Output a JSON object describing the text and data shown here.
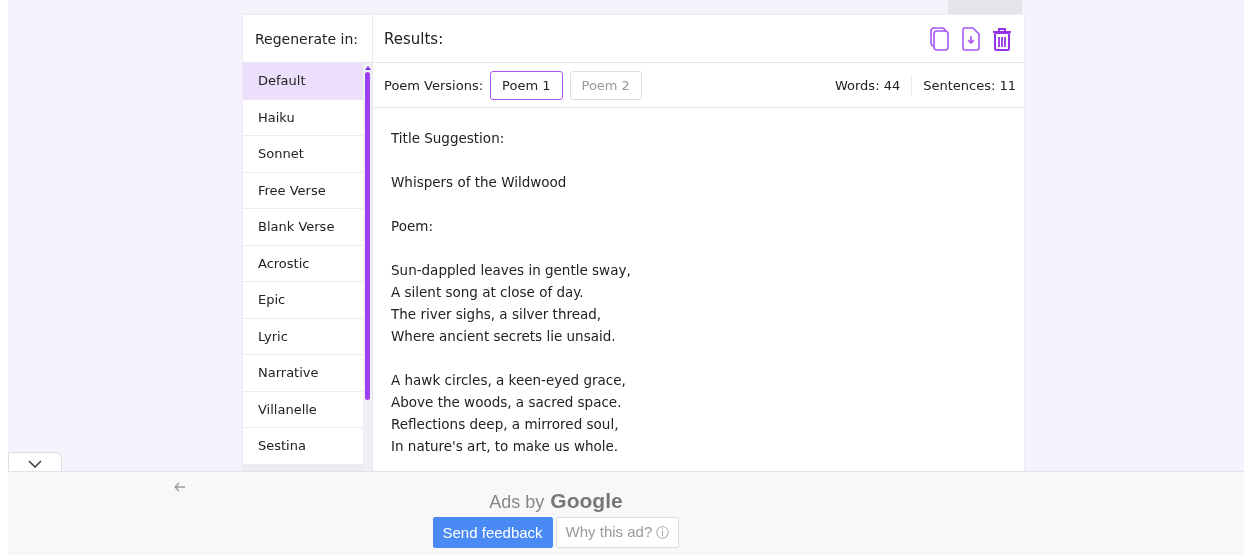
{
  "sidebar": {
    "title": "Regenerate in:",
    "items": [
      {
        "label": "Default",
        "selected": true
      },
      {
        "label": "Haiku",
        "selected": false
      },
      {
        "label": "Sonnet",
        "selected": false
      },
      {
        "label": "Free Verse",
        "selected": false
      },
      {
        "label": "Blank Verse",
        "selected": false
      },
      {
        "label": "Acrostic",
        "selected": false
      },
      {
        "label": "Epic",
        "selected": false
      },
      {
        "label": "Lyric",
        "selected": false
      },
      {
        "label": "Narrative",
        "selected": false
      },
      {
        "label": "Villanelle",
        "selected": false
      },
      {
        "label": "Sestina",
        "selected": false
      }
    ]
  },
  "results": {
    "title": "Results:",
    "versions_label": "Poem Versions:",
    "versions": [
      {
        "label": "Poem 1",
        "selected": true
      },
      {
        "label": "Poem 2",
        "selected": false
      }
    ],
    "stats": [
      "Words: 44",
      "Sentences: 11"
    ],
    "paragraphs": [
      [
        "Title Suggestion:"
      ],
      [
        "Whispers of the Wildwood"
      ],
      [
        "Poem:"
      ],
      [
        "Sun-dappled leaves in gentle sway,",
        "A silent song at close of day.",
        "The river sighs, a silver thread,",
        "Where ancient secrets lie unsaid."
      ],
      [
        "A hawk circles, a keen-eyed grace,",
        "Above the woods, a sacred space.",
        "Reflections deep, a mirrored soul,",
        "In nature's art, to make us whole."
      ]
    ]
  },
  "ads": {
    "label": "Ads by",
    "brand": "Google",
    "buttons": [
      {
        "label": "Send feedback",
        "kind": "primary"
      },
      {
        "label": "Why this ad?",
        "kind": "info",
        "icon": "ⓘ"
      }
    ]
  }
}
